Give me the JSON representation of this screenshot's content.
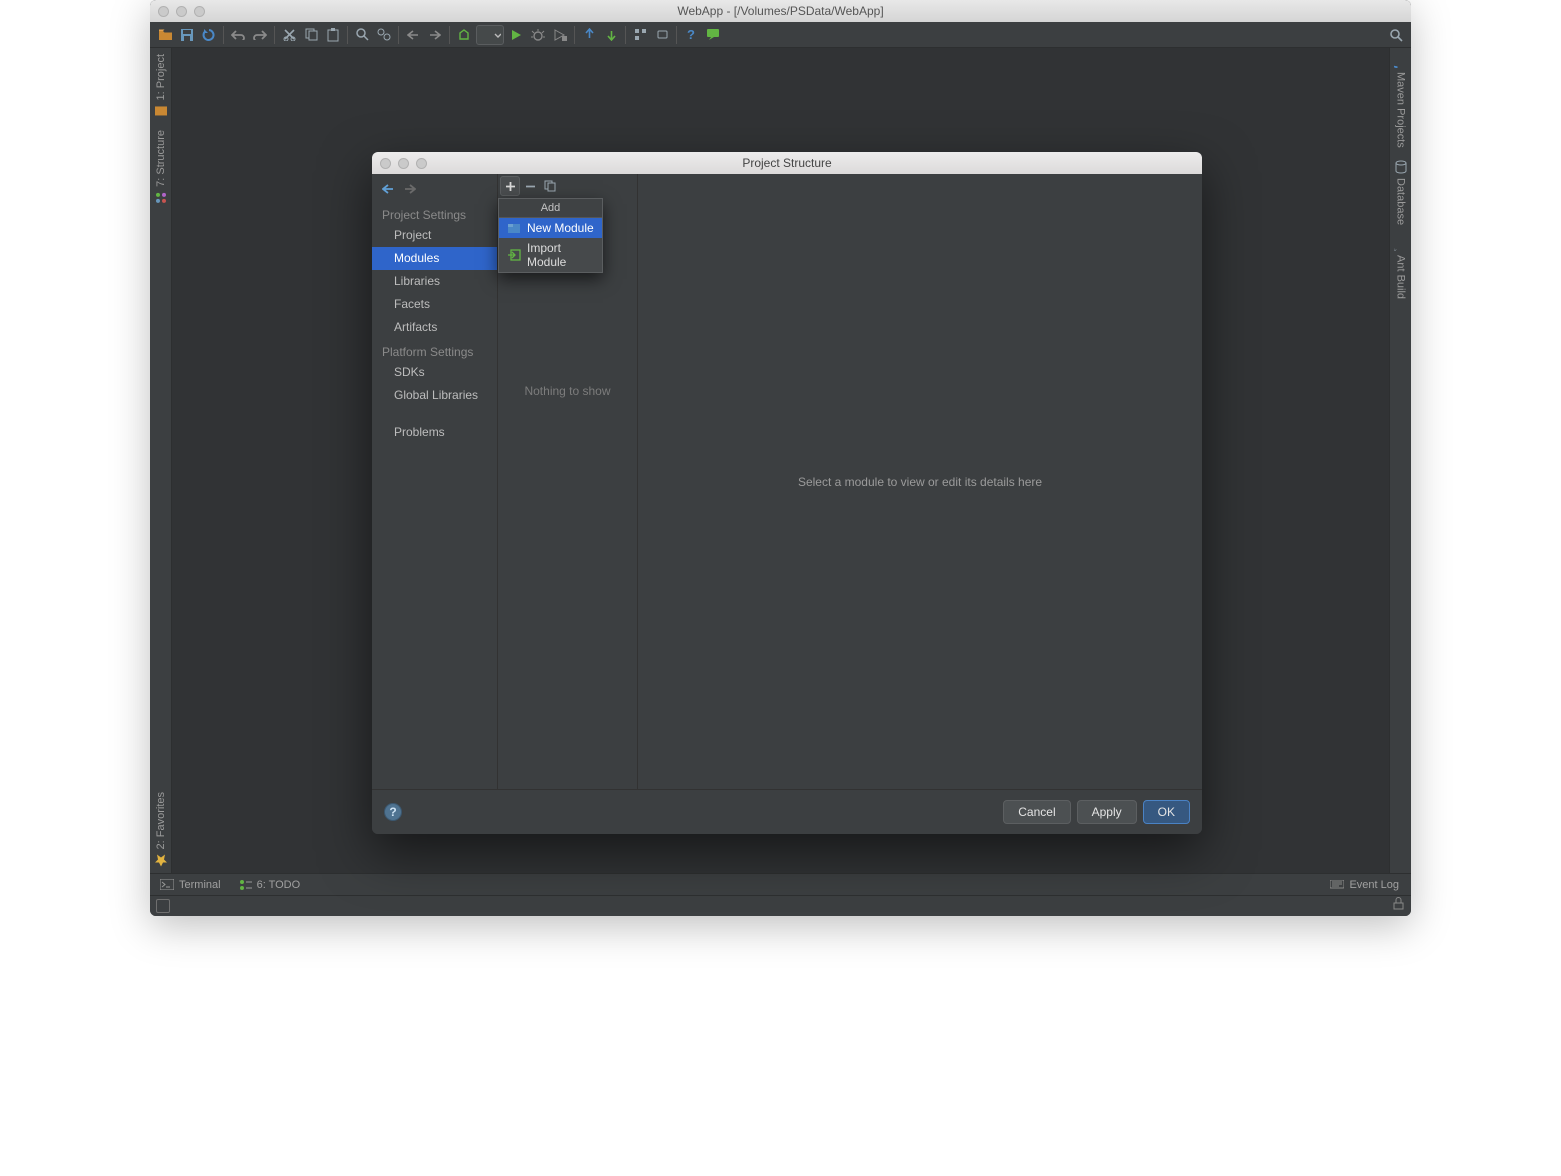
{
  "window": {
    "title": "WebApp - [/Volumes/PSData/WebApp]"
  },
  "gutters": {
    "left": {
      "project": "1: Project",
      "structure": "7: Structure",
      "favorites": "2: Favorites"
    },
    "right": {
      "maven": "Maven Projects",
      "database": "Database",
      "ant": "Ant Build"
    }
  },
  "statusbar": {
    "terminal": "Terminal",
    "todo": "6: TODO",
    "eventlog": "Event Log"
  },
  "dialog": {
    "title": "Project Structure",
    "sidebar": {
      "project_settings": "Project Settings",
      "project": "Project",
      "modules": "Modules",
      "libraries": "Libraries",
      "facets": "Facets",
      "artifacts": "Artifacts",
      "platform_settings": "Platform Settings",
      "sdks": "SDKs",
      "global_libraries": "Global Libraries",
      "problems": "Problems"
    },
    "mid": {
      "empty": "Nothing to show"
    },
    "detail": "Select a module to view or edit its details here",
    "popup": {
      "header": "Add",
      "new_module": "New Module",
      "import_module": "Import Module"
    },
    "buttons": {
      "cancel": "Cancel",
      "apply": "Apply",
      "ok": "OK"
    }
  }
}
